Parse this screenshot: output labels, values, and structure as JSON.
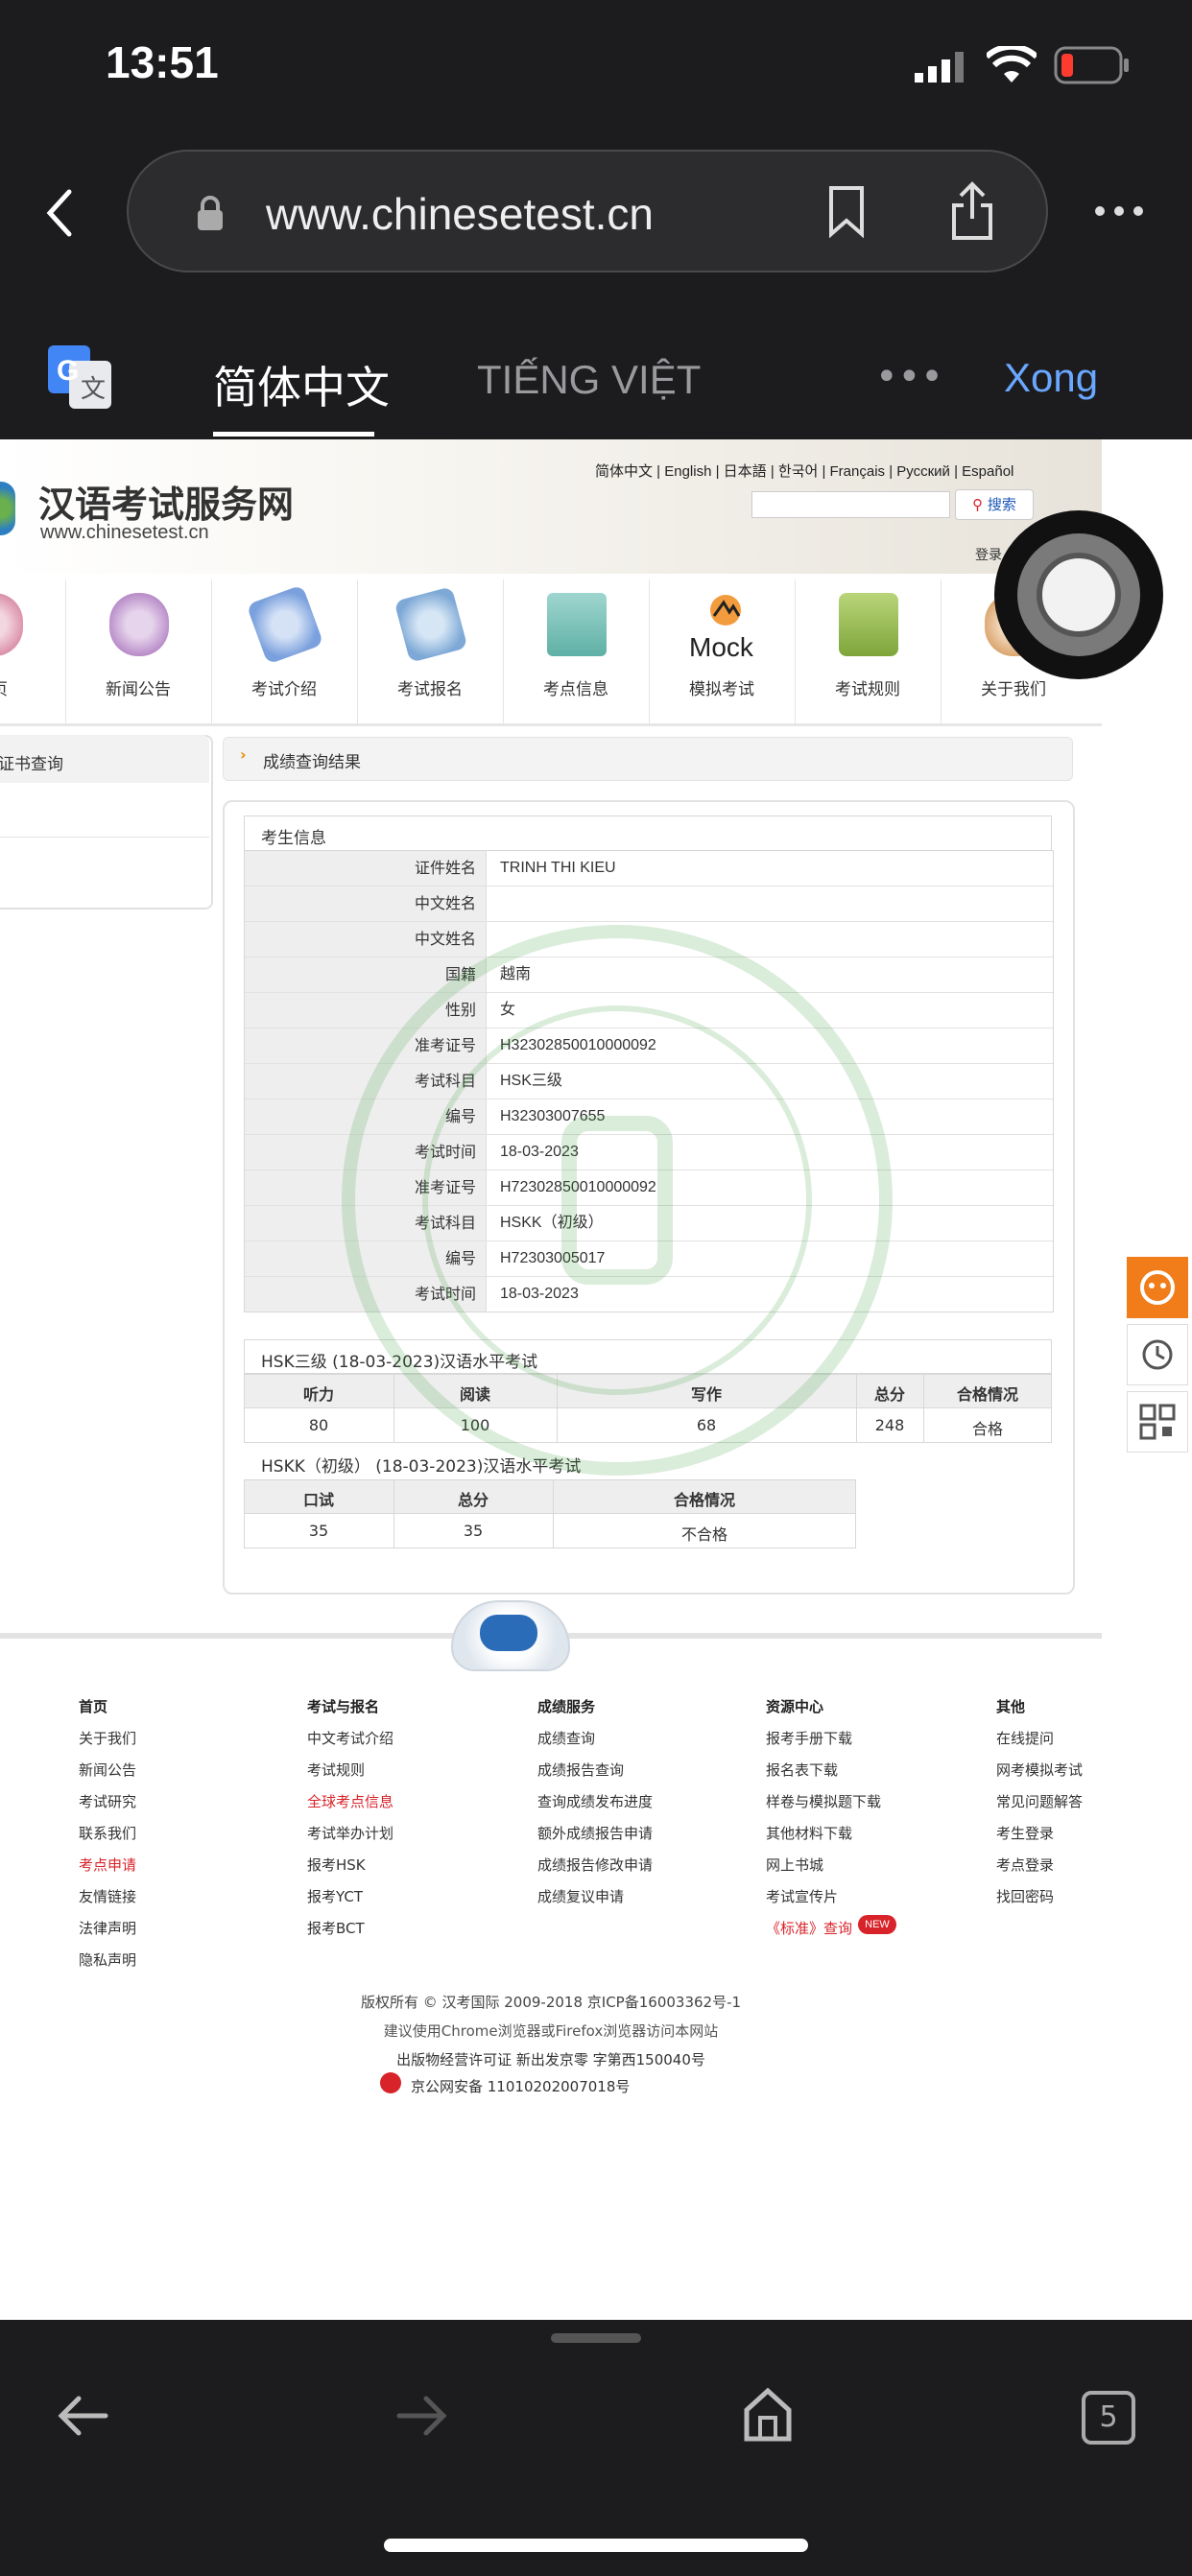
{
  "status_bar": {
    "time": "13:51"
  },
  "browser": {
    "url": "www.chinesetest.cn",
    "tab_count": "5"
  },
  "translate_bar": {
    "lang_active": "简体中文",
    "lang_other": "TIẾNG VIỆT",
    "more": "•••",
    "done": "Xong"
  },
  "site": {
    "title": "汉语考试服务网",
    "url": "www.chinesetest.cn",
    "languages": "简体中文 | English | 日本語 | 한국어 | Français | Pусский | Español",
    "search_button": "搜索",
    "login": "登录"
  },
  "nav": [
    {
      "label": "页"
    },
    {
      "label": "新闻公告"
    },
    {
      "label": "考试介绍"
    },
    {
      "label": "考试报名"
    },
    {
      "label": "考点信息"
    },
    {
      "label": "模拟考试"
    },
    {
      "label": "考试规则"
    },
    {
      "label": "关于我们"
    }
  ],
  "nav_mock_text": "Mock",
  "side": {
    "header": "证书查询"
  },
  "breadcrumb": "成绩查询结果",
  "candidate": {
    "section": "考生信息",
    "rows": [
      {
        "label": "证件姓名",
        "value": "TRINH THI KIEU"
      },
      {
        "label": "中文姓名",
        "value": ""
      },
      {
        "label": "中文姓名",
        "value": ""
      },
      {
        "label": "国籍",
        "value": "越南"
      },
      {
        "label": "性别",
        "value": "女"
      },
      {
        "label": "准考证号",
        "value": "H32302850010000092"
      },
      {
        "label": "考试科目",
        "value": "HSK三级"
      },
      {
        "label": "编号",
        "value": "H32303007655"
      },
      {
        "label": "考试时间",
        "value": "18-03-2023"
      },
      {
        "label": "准考证号",
        "value": "H72302850010000092"
      },
      {
        "label": "考试科目",
        "value": "HSKK（初级）"
      },
      {
        "label": "编号",
        "value": "H72303005017"
      },
      {
        "label": "考试时间",
        "value": "18-03-2023"
      }
    ]
  },
  "hsk": {
    "title": "HSK三级 (18-03-2023)汉语水平考试",
    "headers": [
      "听力",
      "阅读",
      "写作",
      "总分",
      "合格情况"
    ],
    "values": [
      "80",
      "100",
      "68",
      "248",
      "合格"
    ]
  },
  "hskk": {
    "title": "HSKK（初级） (18-03-2023)汉语水平考试",
    "headers": [
      "口试",
      "总分",
      "合格情况"
    ],
    "values": [
      "35",
      "35",
      "不合格"
    ]
  },
  "footer": {
    "cols": [
      {
        "head": "首页",
        "items": [
          "关于我们",
          "新闻公告",
          "考试研究",
          "联系我们",
          "考点申请",
          "友情链接",
          "法律声明",
          "隐私声明"
        ]
      },
      {
        "head": "考试与报名",
        "items": [
          "中文考试介绍",
          "考试规则",
          "全球考点信息",
          "考试举办计划",
          "报考HSK",
          "报考YCT",
          "报考BCT"
        ]
      },
      {
        "head": "成绩服务",
        "items": [
          "成绩查询",
          "成绩报告查询",
          "查询成绩发布进度",
          "额外成绩报告申请",
          "成绩报告修改申请",
          "成绩复议申请"
        ]
      },
      {
        "head": "资源中心",
        "items": [
          "报考手册下载",
          "报名表下载",
          "样卷与模拟题下载",
          "其他材料下载",
          "网上书城",
          "考试宣传片",
          "《标准》查询"
        ]
      },
      {
        "head": "其他",
        "items": [
          "在线提问",
          "网考模拟考试",
          "常见问题解答",
          "考生登录",
          "考点登录",
          "找回密码"
        ]
      }
    ],
    "new_badge": "NEW",
    "copyright": "版权所有 © 汉考国际 2009-2018  京ICP备16003362号-1",
    "browser_note": "建议使用Chrome浏览器或Firefox浏览器访问本网站",
    "license": "出版物经营许可证 新出发京零 字第西150040号",
    "police": "京公网安备 11010202007018号"
  },
  "colors": {
    "accent_orange": "#f07d1a",
    "link_red": "#d8232a",
    "translate_blue": "#6aa7ff"
  }
}
